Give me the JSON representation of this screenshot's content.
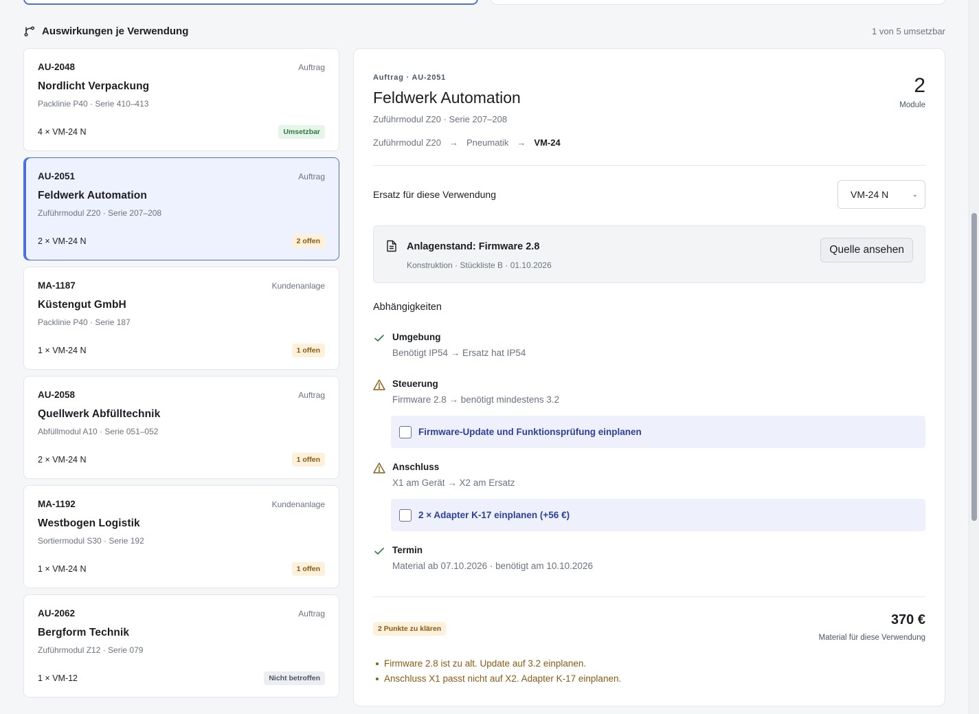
{
  "section": {
    "icon": "branch-icon",
    "title": "Auswirkungen je Verwendung",
    "count": "1 von 5 umsetzbar"
  },
  "cards": [
    {
      "id": "AU-2048",
      "type": "Auftrag",
      "name": "Nordlicht Verpackung",
      "sub": "Packlinie P40 · Serie 410–413",
      "qty": "4 × VM-24 N",
      "badge": "Umsetzbar",
      "badge_color": "green",
      "selected": false
    },
    {
      "id": "AU-2051",
      "type": "Auftrag",
      "name": "Feldwerk Automation",
      "sub": "Zuführmodul Z20 · Serie 207–208",
      "qty": "2 × VM-24 N",
      "badge": "2 offen",
      "badge_color": "amber",
      "selected": true
    },
    {
      "id": "MA-1187",
      "type": "Kundenanlage",
      "name": "Küstengut GmbH",
      "sub": "Packlinie P40 · Serie 187",
      "qty": "1 × VM-24 N",
      "badge": "1 offen",
      "badge_color": "amber",
      "selected": false
    },
    {
      "id": "AU-2058",
      "type": "Auftrag",
      "name": "Quellwerk Abfülltechnik",
      "sub": "Abfüllmodul A10 · Serie 051–052",
      "qty": "2 × VM-24 N",
      "badge": "1 offen",
      "badge_color": "amber",
      "selected": false
    },
    {
      "id": "MA-1192",
      "type": "Kundenanlage",
      "name": "Westbogen Logistik",
      "sub": "Sortiermodul S30 · Serie 192",
      "qty": "1 × VM-24 N",
      "badge": "1 offen",
      "badge_color": "amber",
      "selected": false
    },
    {
      "id": "AU-2062",
      "type": "Auftrag",
      "name": "Bergform Technik",
      "sub": "Zuführmodul Z12 · Serie 079",
      "qty": "1 × VM-12",
      "badge": "Nicht betroffen",
      "badge_color": "gray",
      "selected": false
    }
  ],
  "detail": {
    "kicker": "Auftrag · AU-2051",
    "title": "Feldwerk Automation",
    "sub": "Zuführmodul Z20 · Serie 207–208",
    "count": "2",
    "count_label": "Module",
    "path": [
      "Zuführmodul Z20",
      "Pneumatik",
      "VM-24"
    ],
    "replacement_label": "Ersatz für diese Verwendung",
    "replacement_value": "VM-24 N",
    "source": {
      "icon": "document-icon",
      "title": "Anlagenstand: Firmware 2.8",
      "sub": "Konstruktion · Stückliste B · 01.10.2026",
      "button": "Quelle ansehen"
    },
    "deps_title": "Abhängigkeiten",
    "deps": [
      {
        "status": "ok",
        "icon": "check-icon",
        "title": "Umgebung",
        "text": "Benötigt IP54 → Ersatz hat IP54"
      },
      {
        "status": "warn",
        "icon": "warning-icon",
        "title": "Steuerung",
        "text": "Firmware 2.8 → benötigt mindestens 3.2",
        "action": "Firmware-Update und Funktionsprüfung einplanen"
      },
      {
        "status": "warn",
        "icon": "warning-icon",
        "title": "Anschluss",
        "text": "X1 am Gerät → X2 am Ersatz",
        "action": "2 × Adapter K-17 einplanen (+56 €)"
      },
      {
        "status": "ok",
        "icon": "check-icon",
        "title": "Termin",
        "text": "Material ab 07.10.2026 · benötigt am 10.10.2026"
      }
    ],
    "summary_badge": "2 Punkte zu klären",
    "total_value": "370 €",
    "total_label": "Material für diese Verwendung",
    "issues": [
      "Firmware 2.8 ist zu alt. Update auf 3.2 einplanen.",
      "Anschluss X1 passt nicht auf X2. Adapter K-17 einplanen."
    ]
  },
  "colors": {
    "accent": "#4b6fe0",
    "warning": "#8a5a14",
    "ok": "#2f7a44"
  }
}
